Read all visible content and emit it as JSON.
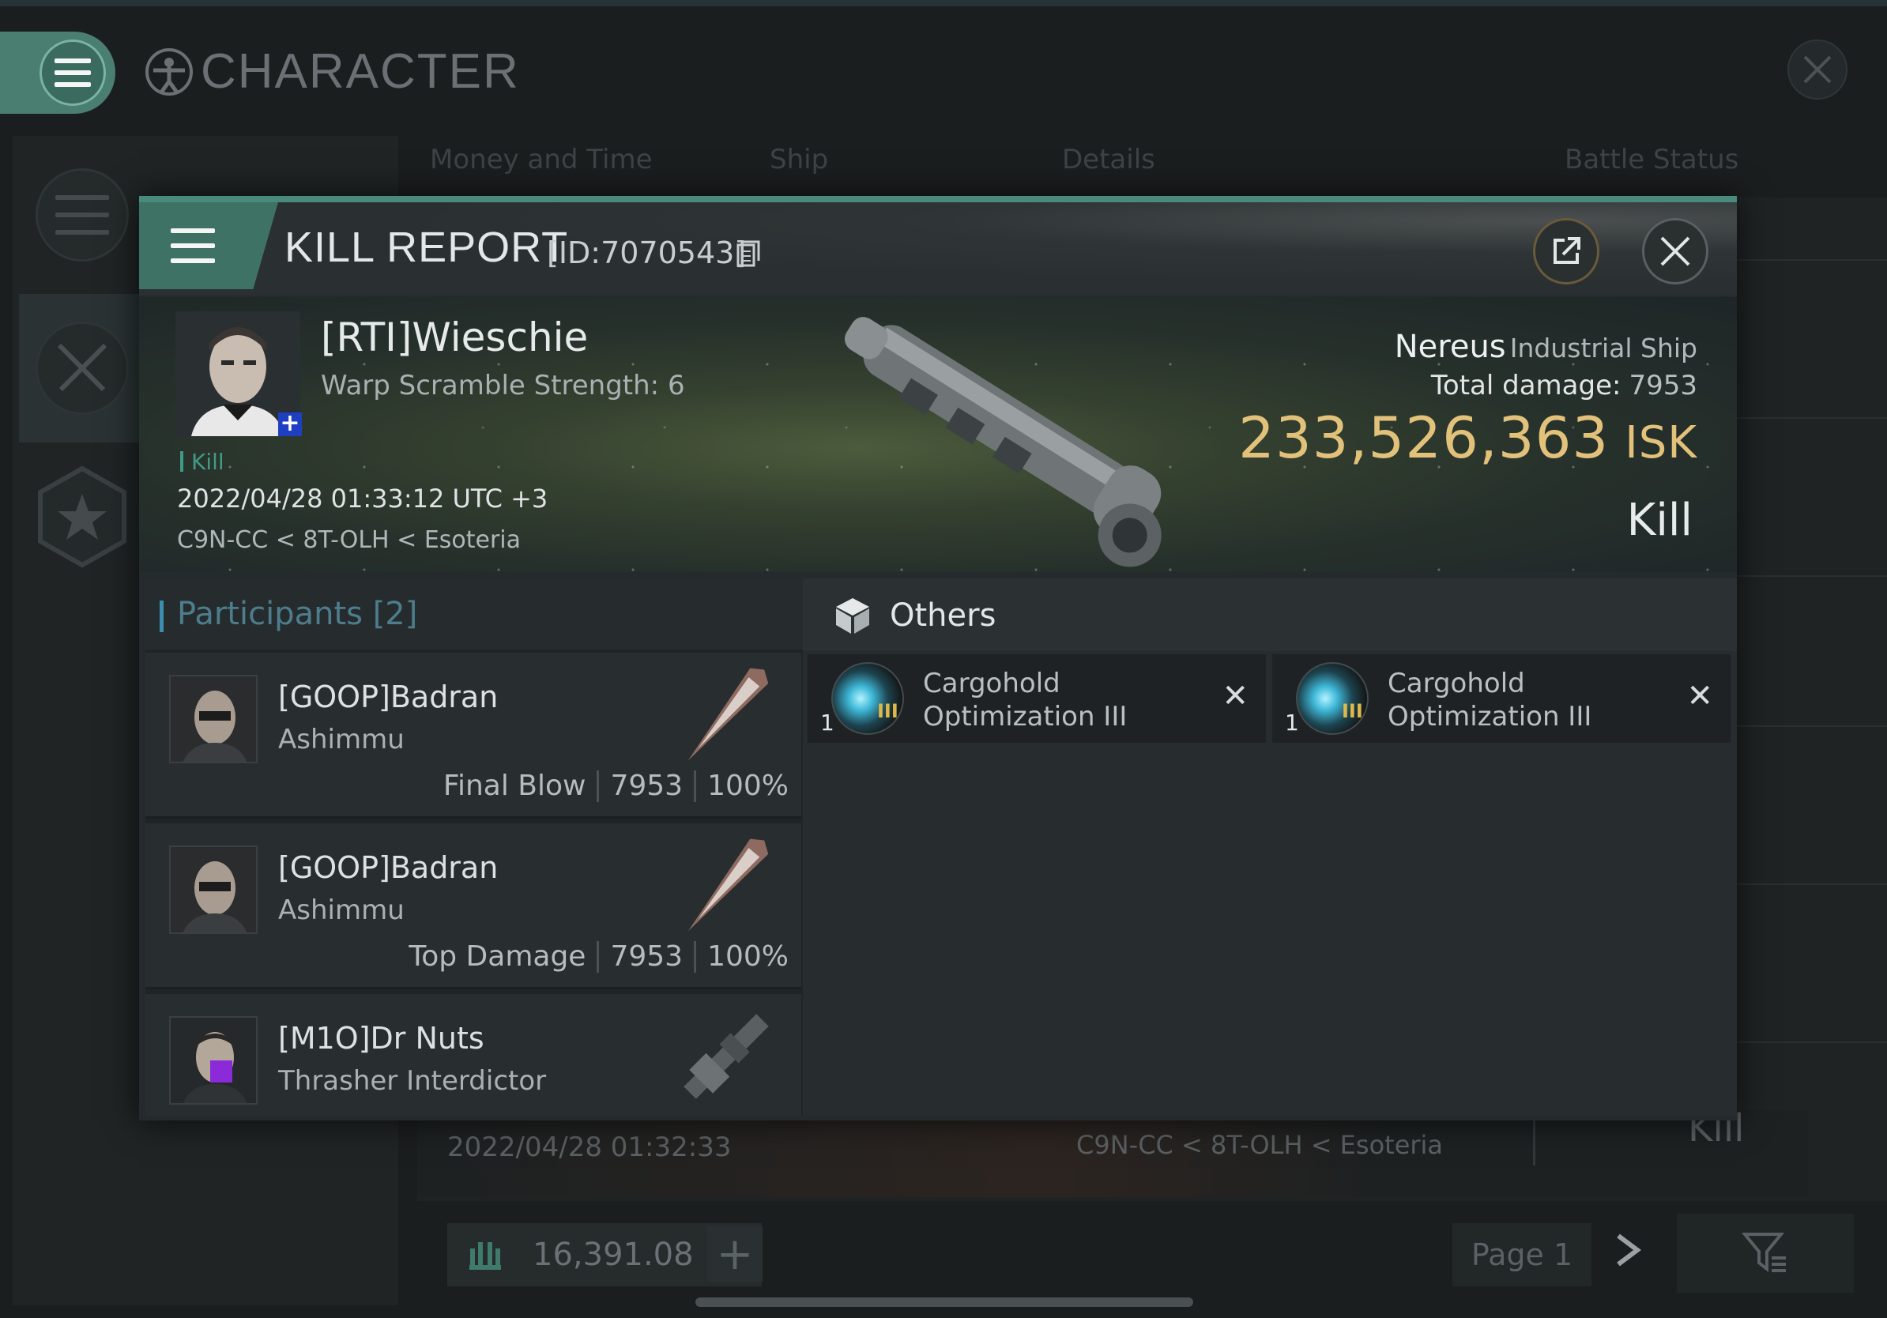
{
  "app": {
    "title": "CHARACTER",
    "bg_tabs": [
      "Money and Time",
      "Ship",
      "Details",
      "Battle Status"
    ],
    "bg_row": {
      "date": "2022/04/28 01:32:33",
      "location": "C9N-CC < 8T-OLH < Esoteria",
      "result": "Kill"
    },
    "isk_balance": "16,391.08",
    "page_label": "Page 1"
  },
  "kill_report": {
    "title": "KILL REPORT",
    "id_label": "[ID:7070543]",
    "victim": {
      "name": "[RTI]Wieschie",
      "subtitle": "Warp Scramble Strength: 6",
      "tag": "Kill",
      "datetime": "2022/04/28 01:33:12 UTC +3",
      "location": "C9N-CC < 8T-OLH < Esoteria",
      "ship_name": "Nereus",
      "ship_class": "Industrial Ship",
      "total_damage_label": "Total damage:",
      "total_damage": "7953",
      "isk_value": "233,526,363",
      "isk_unit": "ISK",
      "result": "Kill"
    },
    "participants": {
      "title": "Participants",
      "count": "[2]",
      "rows": [
        {
          "name": "[GOOP]Badran",
          "ship": "Ashimmu",
          "role": "Final Blow",
          "damage": "7953",
          "percent": "100%"
        },
        {
          "name": "[GOOP]Badran",
          "ship": "Ashimmu",
          "role": "Top Damage",
          "damage": "7953",
          "percent": "100%"
        },
        {
          "name": "[M1O]Dr Nuts",
          "ship": "Thrasher Interdictor",
          "role": "",
          "damage": "",
          "percent": ""
        }
      ]
    },
    "others": {
      "title": "Others",
      "items": [
        {
          "qty": "1",
          "tier": "III",
          "name": "Cargohold Optimization III"
        },
        {
          "qty": "1",
          "tier": "III",
          "name": "Cargohold Optimization III"
        }
      ]
    }
  },
  "colors": {
    "accent": "#4a8a7c",
    "isk_gold": "#e2c27a",
    "participants_blue": "#4d7d8c"
  }
}
